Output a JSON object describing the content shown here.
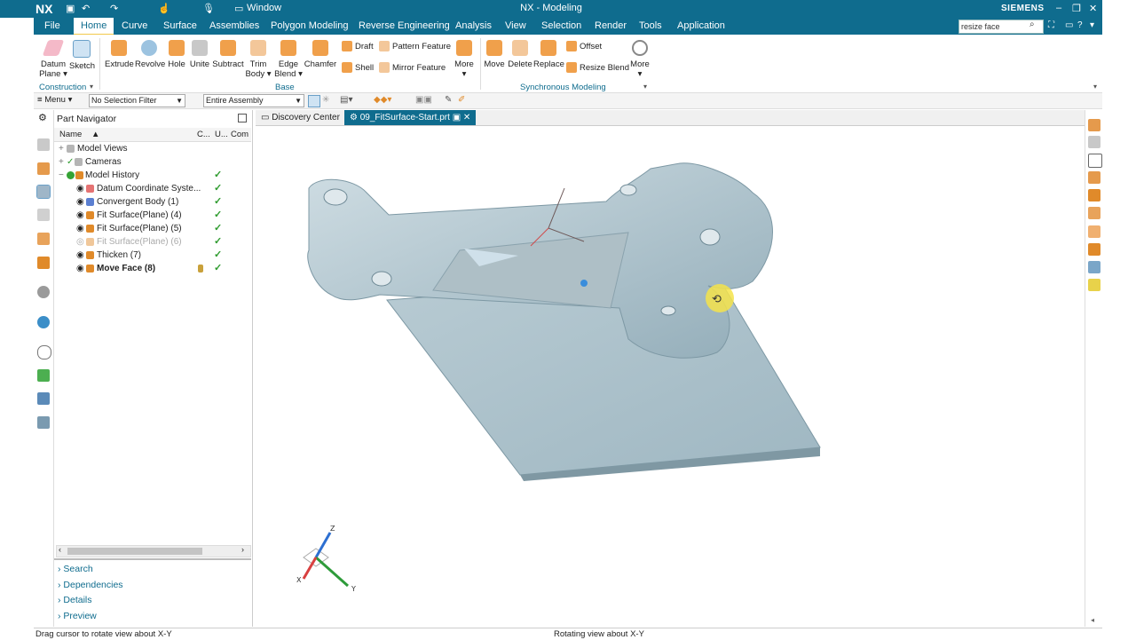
{
  "titlebar": {
    "logo": "NX",
    "window_menu": "Window",
    "title": "NX - Modeling",
    "brand": "SIEMENS"
  },
  "menu": {
    "tabs": [
      "File",
      "Home",
      "Curve",
      "Surface",
      "Assemblies",
      "Polygon Modeling",
      "Reverse Engineering",
      "Analysis",
      "View",
      "Selection",
      "Render",
      "Tools",
      "Application"
    ],
    "active": "Home",
    "search_value": "resize face"
  },
  "ribbon": {
    "construction": {
      "datum_plane": "Datum Plane",
      "sketch": "Sketch",
      "group_label": "Construction"
    },
    "base": {
      "extrude": "Extrude",
      "revolve": "Revolve",
      "hole": "Hole",
      "unite": "Unite",
      "subtract": "Subtract",
      "trim_body": "Trim Body",
      "edge_blend": "Edge Blend",
      "chamfer": "Chamfer",
      "draft": "Draft",
      "shell": "Shell",
      "pattern_feature": "Pattern Feature",
      "mirror_feature": "Mirror Feature",
      "more": "More",
      "group_label": "Base"
    },
    "sync": {
      "move": "Move",
      "delete": "Delete",
      "replace": "Replace",
      "offset": "Offset",
      "resize_blend": "Resize Blend",
      "more": "More",
      "group_label": "Synchronous Modeling"
    }
  },
  "selection_bar": {
    "menu": "Menu",
    "filter": "No Selection Filter",
    "scope": "Entire Assembly"
  },
  "navigator": {
    "title": "Part Navigator",
    "columns": [
      "Name",
      "C...",
      "U...",
      "Com"
    ],
    "rows": [
      {
        "label": "Model Views",
        "indent": 0
      },
      {
        "label": "Cameras",
        "indent": 0
      },
      {
        "label": "Model History",
        "indent": 0
      },
      {
        "label": "Datum Coordinate Syste...",
        "indent": 1
      },
      {
        "label": "Convergent Body (1)",
        "indent": 1
      },
      {
        "label": "Fit Surface(Plane) (4)",
        "indent": 1
      },
      {
        "label": "Fit Surface(Plane) (5)",
        "indent": 1
      },
      {
        "label": "Fit Surface(Plane) (6)",
        "indent": 1
      },
      {
        "label": "Thicken (7)",
        "indent": 1
      },
      {
        "label": "Move Face (8)",
        "indent": 1
      }
    ],
    "panels": [
      "Search",
      "Dependencies",
      "Details",
      "Preview"
    ]
  },
  "doc_tabs": {
    "discovery": "Discovery Center",
    "part": "09_FitSurface-Start.prt"
  },
  "triad": {
    "z": "Z",
    "y": "Y",
    "x": "X"
  },
  "status": {
    "left": "Drag cursor to rotate view about X-Y",
    "center": "Rotating view about X-Y"
  }
}
